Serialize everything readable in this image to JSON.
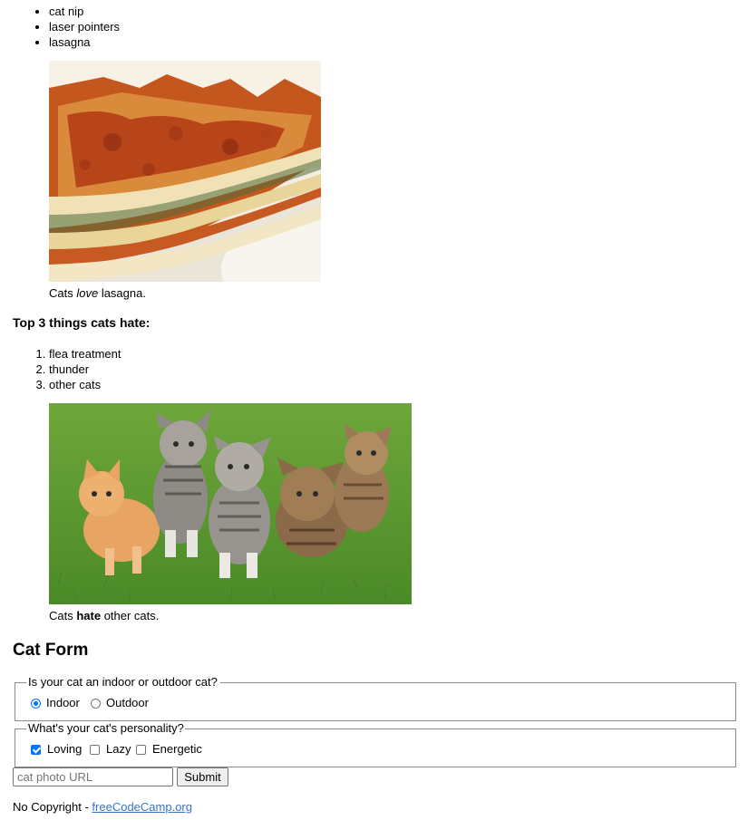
{
  "likes": {
    "items": [
      "cat nip",
      "laser pointers",
      "lasagna"
    ]
  },
  "lasagna_figure": {
    "image_alt": "A slice of lasagna on a plate.",
    "caption_before": "Cats ",
    "caption_em": "love",
    "caption_after": " lasagna."
  },
  "hates": {
    "heading": "Top 3 things cats hate:",
    "items": [
      "flea treatment",
      "thunder",
      "other cats"
    ]
  },
  "cats_figure": {
    "image_alt": "Five cats looking around a field.",
    "caption_before": "Cats ",
    "caption_strong": "hate",
    "caption_after": " other cats."
  },
  "form": {
    "title": "Cat Form",
    "location": {
      "legend": "Is your cat an indoor or outdoor cat?",
      "options": [
        {
          "label": "Indoor",
          "checked": true
        },
        {
          "label": "Outdoor",
          "checked": false
        }
      ]
    },
    "personality": {
      "legend": "What's your cat's personality?",
      "options": [
        {
          "label": "Loving",
          "checked": true
        },
        {
          "label": "Lazy",
          "checked": false
        },
        {
          "label": "Energetic",
          "checked": false
        }
      ]
    },
    "url_placeholder": "cat photo URL",
    "submit_label": "Submit"
  },
  "footer": {
    "text": "No Copyright - ",
    "link_text": "freeCodeCamp.org"
  },
  "colors": {
    "accent": "#0075ff",
    "link": "#3b73c4",
    "border": "#8a8a8a"
  }
}
